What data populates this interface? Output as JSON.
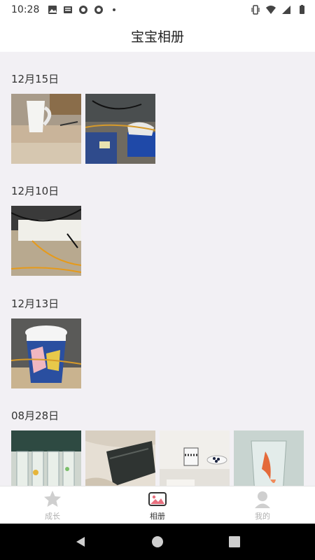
{
  "status_bar": {
    "time": "10:28",
    "left_icons": [
      "image-icon",
      "news-icon",
      "chat-bubble-icon",
      "chat-bubble-icon",
      "dot-icon"
    ],
    "right_icons": [
      "vibrate-icon",
      "wifi-icon",
      "signal-icon",
      "battery-icon"
    ]
  },
  "header": {
    "title": "宝宝相册"
  },
  "albums": [
    {
      "date": "12月15日",
      "photos": [
        "mug-on-desk",
        "desk-cables-blue-box"
      ]
    },
    {
      "date": "12月10日",
      "photos": [
        "desk-cables"
      ]
    },
    {
      "date": "12月13日",
      "photos": [
        "coffee-cup"
      ]
    },
    {
      "date": "08月28日",
      "photos": [
        "glass-cups",
        "book-on-fabric",
        "tea-cups",
        "goldfish-glass"
      ]
    }
  ],
  "tab_bar": {
    "tabs": [
      {
        "label": "成长",
        "icon": "star-icon",
        "active": false
      },
      {
        "label": "相册",
        "icon": "photo-album-icon",
        "active": true
      },
      {
        "label": "我的",
        "icon": "profile-icon",
        "active": false
      }
    ]
  },
  "colors": {
    "background": "#f2f0f4",
    "active_tab": "#e8707f",
    "inactive": "#c8c8c8"
  }
}
